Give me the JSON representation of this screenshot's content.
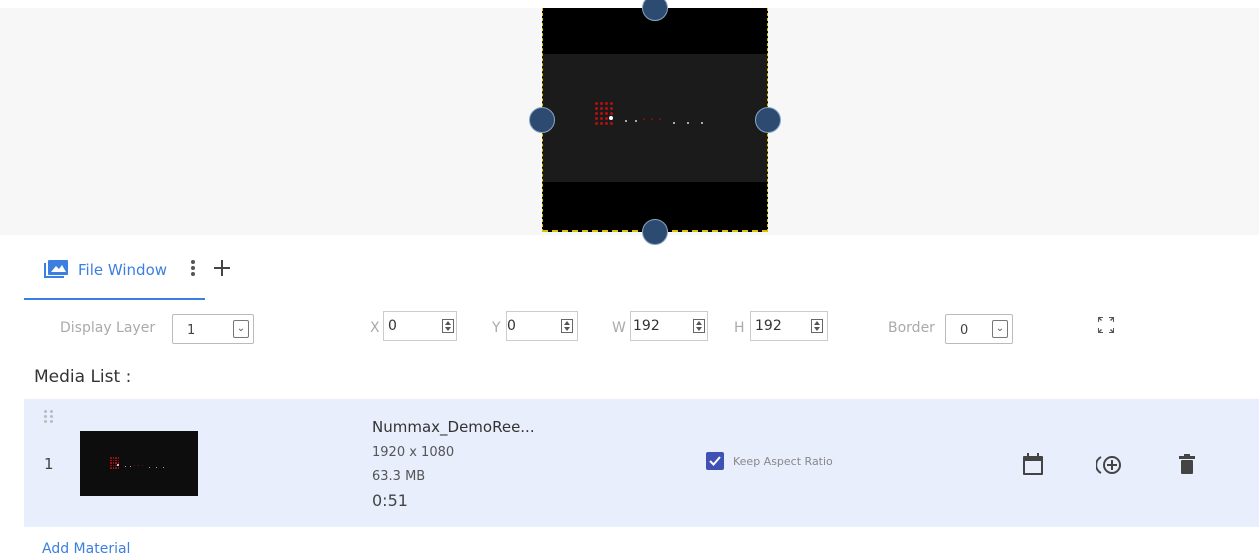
{
  "tab": {
    "label": "File Window",
    "more_icon": "more-vert-icon",
    "add_icon": "plus-icon",
    "tab_icon": "image-gallery-icon"
  },
  "properties": {
    "display_layer_label": "Display Layer",
    "display_layer_value": "1",
    "x_label": "X",
    "x_value": "0",
    "y_label": "Y",
    "y_value": "0",
    "w_label": "W",
    "w_value": "192",
    "h_label": "H",
    "h_value": "192",
    "border_label": "Border",
    "border_value": "0",
    "fullscreen_icon": "fullscreen-icon"
  },
  "media_list": {
    "title": "Media List :",
    "items": [
      {
        "index": "1",
        "name": "Nummax_DemoRee...",
        "resolution": "1920 x 1080",
        "size": "63.3 MB",
        "duration": "0:51",
        "keep_aspect_label": "Keep Aspect Ratio",
        "keep_aspect_checked": true
      }
    ],
    "add_material_label": "Add Material"
  },
  "colors": {
    "accent": "#3b7fe0",
    "row_bg": "#e8eefb",
    "checkbox": "#3f51b5"
  }
}
